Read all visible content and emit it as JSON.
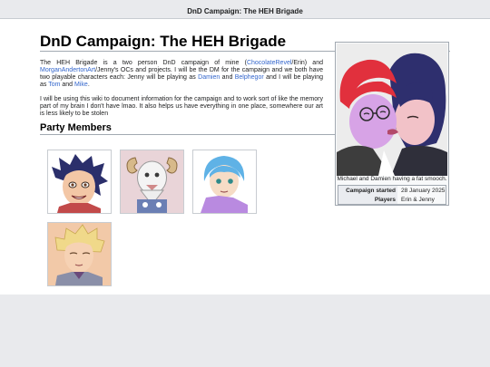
{
  "topbar": {
    "title": "DnD Campaign: The HEH Brigade"
  },
  "page": {
    "title": "DnD Campaign: The HEH Brigade",
    "intro": {
      "p1_part1": "The HEH Brigade is a two person DnD campaign of mine (",
      "link_chocolate": "ChocolateRevel",
      "p1_part2": "/Erin) and ",
      "link_morgan": "MorganAndertonArt",
      "p1_part3": "/Jenny's OCs and projects. I will be the DM for the campaign and we both have two playable characters each: Jenny will be playing as ",
      "link_damien": "Damien",
      "p1_and1": " and ",
      "link_belphegor": "Belphegor",
      "p1_part4": " and I will be playing as ",
      "link_tom": "Tom",
      "p1_and2": " and ",
      "link_mike": "Mike",
      "p1_end": ".",
      "p2": "I will be using this wiki to document information for the campaign and to work sort of like the memory part of my brain I don't have lmao. It also helps us have everything in one place, somewhere our art is less likely to be stolen"
    },
    "section_heading": "Party Members",
    "party_members": [
      {
        "icon": "dark-haired-character-portrait"
      },
      {
        "icon": "horned-goat-character-portrait"
      },
      {
        "icon": "blue-haired-character-portrait"
      },
      {
        "icon": "blonde-character-portrait"
      }
    ]
  },
  "infobox": {
    "image_icon": "two-characters-kissing-illustration",
    "caption": "Michael and Damien having a fat smooch.",
    "rows": [
      {
        "label": "Campaign started",
        "value": "28 January 2025"
      },
      {
        "label": "Players",
        "value": "Erin & Jenny"
      }
    ]
  },
  "colors": {
    "link": "#3366cc",
    "chrome": "#e9eaed",
    "content_bg": "#ffffff",
    "rule": "#a2a9b1"
  }
}
